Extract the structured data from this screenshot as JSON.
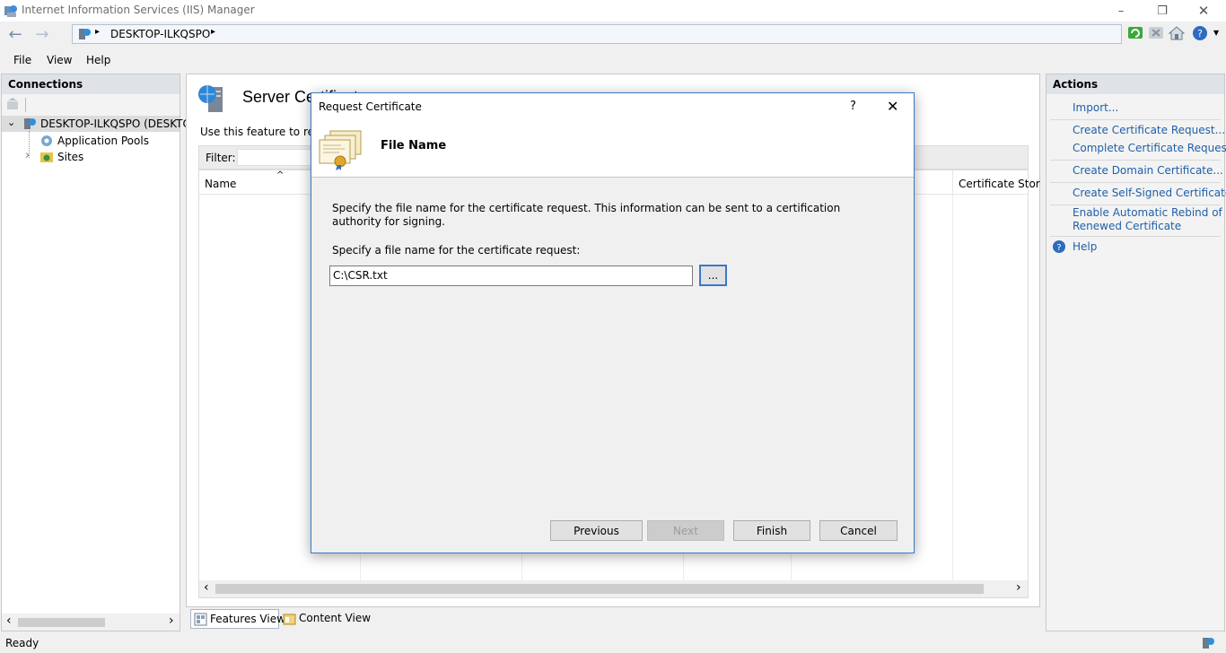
{
  "window": {
    "title": "Internet Information Services (IIS) Manager",
    "minimize": "–",
    "restore": "❐",
    "close": "✕"
  },
  "address": {
    "back": "←",
    "forward": "→",
    "separator": "▸",
    "path": "DESKTOP-ILKQSPO",
    "trailing": "▸"
  },
  "menu": [
    "File",
    "View",
    "Help"
  ],
  "connections": {
    "header": "Connections",
    "tree": [
      {
        "label": "DESKTOP-ILKQSPO (DESKTOP",
        "expander": "⌄"
      },
      {
        "label": "Application Pools",
        "expander": ""
      },
      {
        "label": "Sites",
        "expander": "›"
      }
    ],
    "scroll_left": "‹",
    "scroll_right": "›"
  },
  "center": {
    "title": "Server Certificat",
    "description": "Use this feature to requ",
    "filter_label": "Filter:",
    "columns": [
      "Name",
      "Certificate Stor"
    ],
    "sort_arrow": "^",
    "scroll_left": "‹",
    "scroll_right": "›"
  },
  "actions": {
    "header": "Actions",
    "links": [
      "Import...",
      "Create Certificate Request...",
      "Complete Certificate Request...",
      "Create Domain Certificate...",
      "Create Self-Signed Certificate...",
      "Enable Automatic Rebind of",
      "Renewed Certificate",
      "Help"
    ],
    "help_glyph": "?"
  },
  "view_tabs": {
    "features": "Features View",
    "content": "Content View"
  },
  "status": {
    "text": "Ready"
  },
  "dialog": {
    "title": "Request Certificate",
    "help": "?",
    "close": "✕",
    "heading": "File Name",
    "instruction": "Specify the file name for the certificate request. This information can be sent to a certification authority for signing.",
    "field_label": "Specify a file name for the certificate request:",
    "field_value": "C:\\CSR.txt",
    "browse": "...",
    "buttons": {
      "previous": "Previous",
      "next": "Next",
      "finish": "Finish",
      "cancel": "Cancel"
    }
  },
  "colors": {
    "link": "#1f5fa8",
    "dialog_border": "#3b78c6",
    "pane_header": "#dfe3e8"
  }
}
